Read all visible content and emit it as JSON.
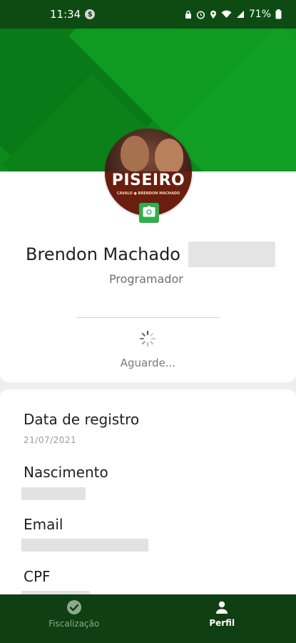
{
  "status_bar": {
    "time": "11:34",
    "notification_glyph": "$",
    "battery": "71%",
    "icons": [
      "lock-icon",
      "alarm-icon",
      "location-icon",
      "wifi-icon",
      "signal-icon",
      "battery-icon"
    ]
  },
  "profile": {
    "name": "Brendon Machado",
    "role": "Programador",
    "avatar_text": "PISEIRO",
    "avatar_subtext": "CAVALO ● BRENDON MACHADO",
    "loading_text": "Aguarde..."
  },
  "info": {
    "registration_label": "Data de registro",
    "registration_value": "21/07/2021",
    "birth_label": "Nascimento",
    "email_label": "Email",
    "cpf_label": "CPF"
  },
  "nav": {
    "items": [
      {
        "label": "Fiscalização",
        "icon": "check-circle-icon",
        "active": false
      },
      {
        "label": "Perfil",
        "icon": "person-icon",
        "active": true
      }
    ]
  },
  "colors": {
    "header_green": "#0c8a1c",
    "nav_background": "#0f3f12",
    "camera_button": "#2fae4b"
  }
}
